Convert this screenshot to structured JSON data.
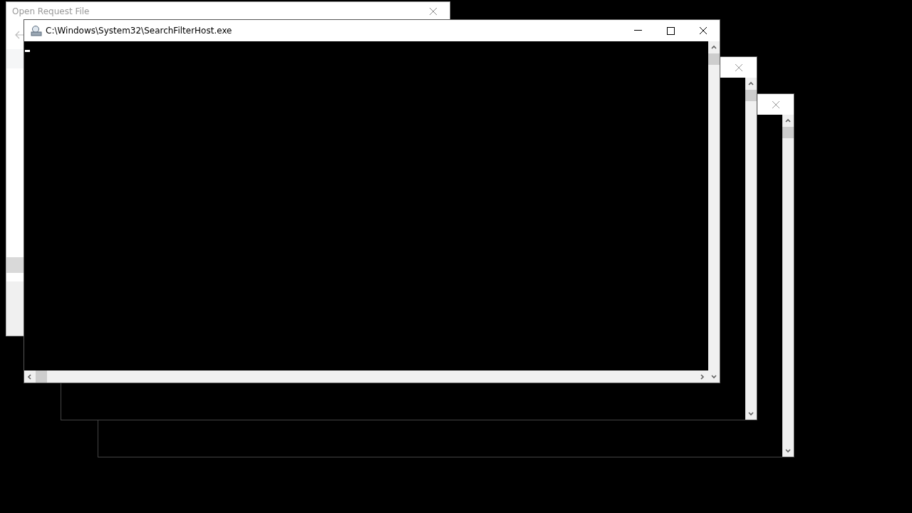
{
  "background_window": {
    "title": "Open Request File"
  },
  "console_window": {
    "title": "C:\\Windows\\System32\\SearchFilterHost.exe"
  }
}
